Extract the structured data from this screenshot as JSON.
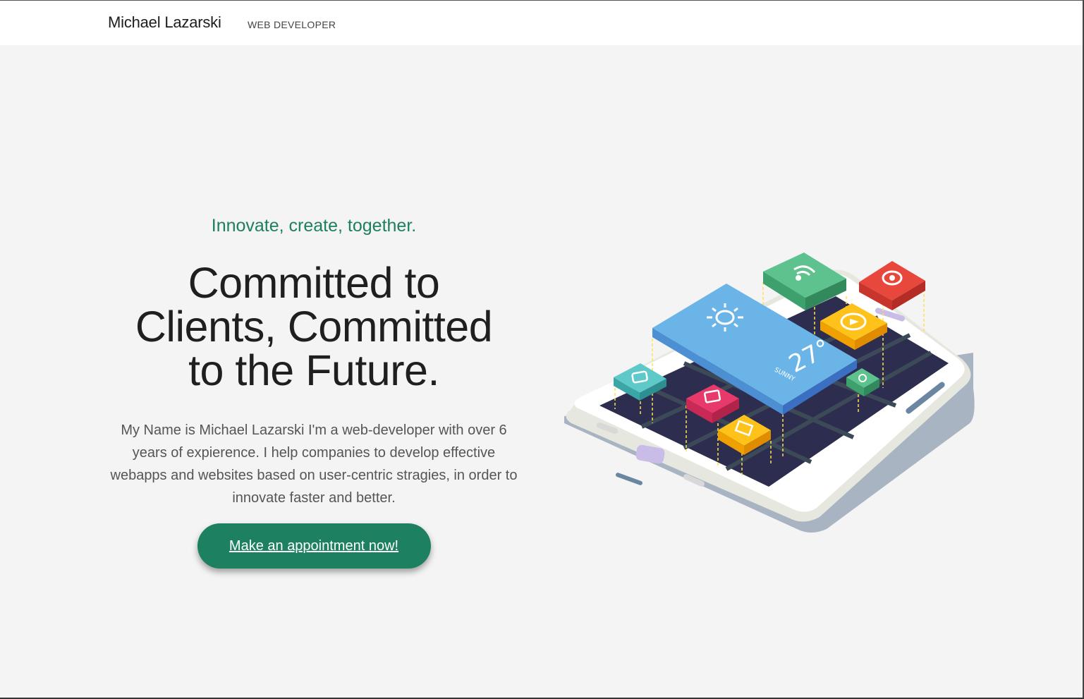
{
  "header": {
    "brand": "Michael Lazarski",
    "role": "WEB DEVELOPER"
  },
  "hero": {
    "tagline": "Innovate, create, together.",
    "headline_lines": [
      "Committed to",
      "Clients, Committed",
      "to the Future."
    ],
    "intro": "My Name is Michael Lazarski I'm a web-developer with over 6 years of expierence. I help companies to develop effective webapps and websites based on user-centric stragies, in order to innovate faster and better.",
    "cta_label": "Make an appointment now!"
  },
  "illustration": {
    "weather_temp": "27°",
    "weather_text": "SUNNY",
    "icons": [
      "rss-icon",
      "location-pin-icon",
      "play-icon",
      "weather-sun-icon",
      "chat-icon",
      "battery-icon",
      "image-icon",
      "settings-gear-icon"
    ]
  },
  "colors": {
    "accent": "#1d8060",
    "tagline": "#1d7f5f",
    "background": "#f4f4f4"
  }
}
